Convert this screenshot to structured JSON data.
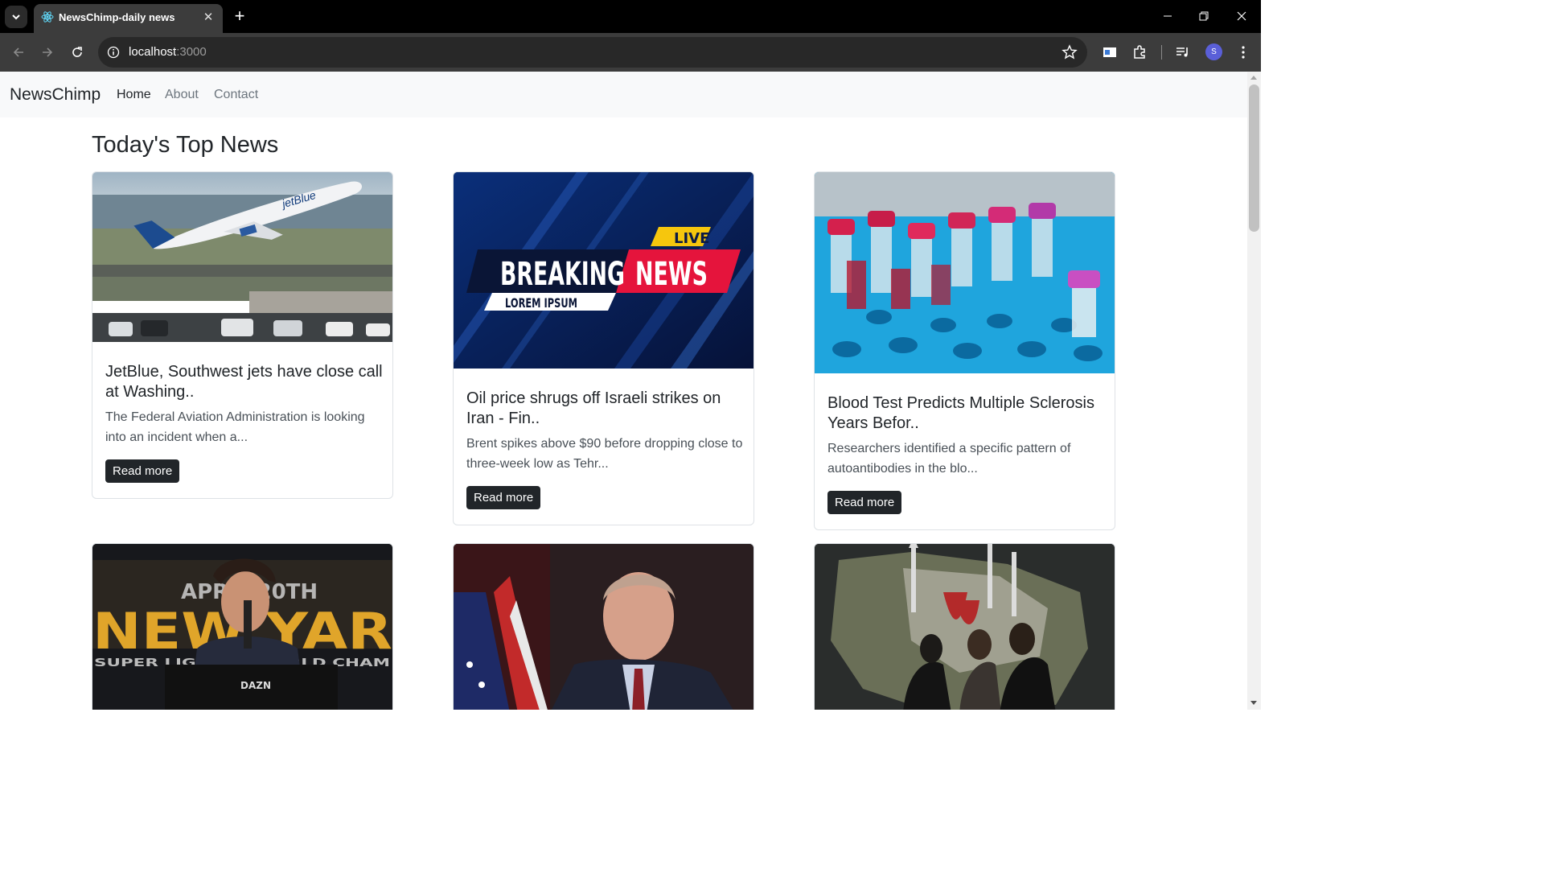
{
  "browser": {
    "tab_title": "NewsChimp-daily news",
    "tab_close": "✕",
    "new_tab": "+",
    "url_host": "localhost",
    "url_port": ":3000",
    "profile_initial": "S"
  },
  "navbar": {
    "brand": "NewsChimp",
    "links": [
      {
        "label": "Home",
        "active": true
      },
      {
        "label": "About",
        "active": false
      },
      {
        "label": "Contact",
        "active": false
      }
    ]
  },
  "page": {
    "heading": "Today's Top News"
  },
  "articles": [
    {
      "image": "photo of a jetBlue airliner taking off",
      "title": "JetBlue, Southwest jets have close call at Washing..",
      "description": "The Federal Aviation Administration is looking into an incident when a...",
      "button": "Read more"
    },
    {
      "image": "breaking news graphic",
      "image_text": {
        "live": "LIVE",
        "breaking": "BREAKING",
        "news": "NEWS",
        "lorem": "LOREM IPSUM"
      },
      "title": "Oil price shrugs off Israeli strikes on Iran - Fin..",
      "description": "Brent spikes above $90 before dropping close to three-week low as Tehr...",
      "button": "Read more"
    },
    {
      "image": "photo of blood sample vials in a rack",
      "title": "Blood Test Predicts Multiple Sclerosis Years Befor..",
      "description": "Researchers identified a specific pattern of autoantibodies in the blo...",
      "button": "Read more"
    },
    {
      "image": "photo of a boxer at a press conference podium",
      "image_text": {
        "banner": "APRIL 20TH",
        "big": "NEW YAR",
        "small": "SUPER LIGHT ... WORLD CHAM",
        "podium": "DAZN"
      },
      "title": "",
      "description": "",
      "button": ""
    },
    {
      "image": "photo of a man in suit in front of US flag",
      "title": "",
      "description": "",
      "button": ""
    },
    {
      "image": "photo of Iran map with missiles and women walking",
      "title": "",
      "description": "",
      "button": ""
    }
  ],
  "colors": {
    "navbar_bg": "#f8f9fa",
    "button_bg": "#212529",
    "chrome_bg": "#3c3c3c"
  }
}
